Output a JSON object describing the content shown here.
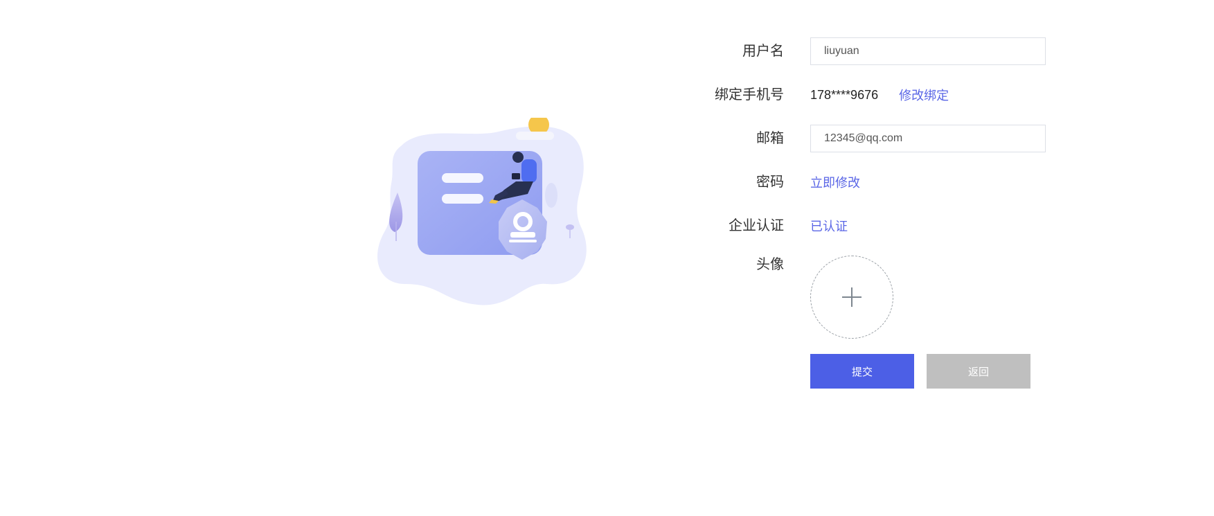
{
  "form": {
    "username": {
      "label": "用户名",
      "value": "liuyuan"
    },
    "phone": {
      "label": "绑定手机号",
      "value": "178****9676",
      "action": "修改绑定"
    },
    "email": {
      "label": "邮箱",
      "value": "12345@qq.com"
    },
    "password": {
      "label": "密码",
      "action": "立即修改"
    },
    "enterprise": {
      "label": "企业认证",
      "status": "已认证"
    },
    "avatar": {
      "label": "头像",
      "icon": "plus-icon"
    },
    "buttons": {
      "submit": "提交",
      "back": "返回"
    }
  },
  "colors": {
    "accent": "#5a66e6",
    "primary_button": "#4c5fe6",
    "secondary_button": "#bfbfbf"
  }
}
